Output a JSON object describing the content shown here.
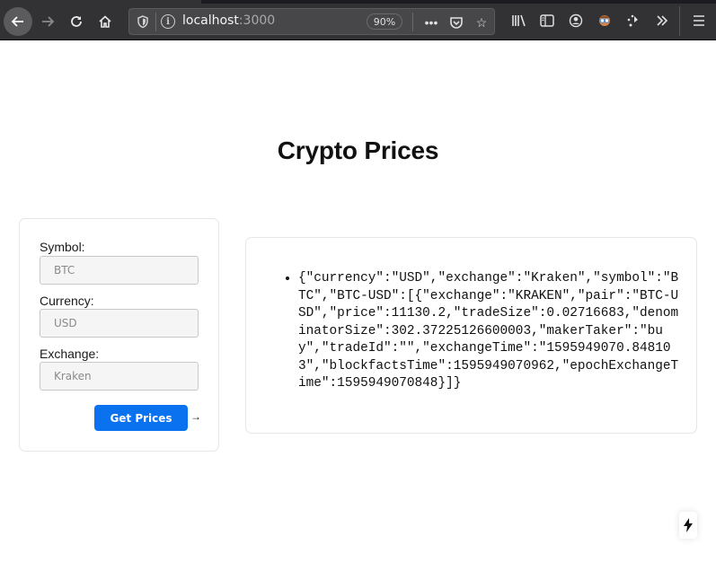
{
  "browser": {
    "url_host": "localhost",
    "url_port": ":3000",
    "zoom_level": "90%",
    "icons": {
      "back": "back-arrow-icon",
      "forward": "forward-arrow-icon",
      "reload": "reload-icon",
      "home": "home-icon",
      "tracking": "shield-icon",
      "info": "info-icon",
      "more": "more-dots-icon",
      "pocket": "pocket-icon",
      "bookmark": "star-icon",
      "library": "library-icon",
      "sidebar": "sidebar-icon",
      "account": "account-icon",
      "extension": "extension-avatar-icon",
      "extension2": "dots-arrow-icon",
      "overflow": "chevron-double-right-icon",
      "menu": "hamburger-menu-icon"
    }
  },
  "page": {
    "title": "Crypto Prices",
    "form": {
      "fields": [
        {
          "label": "Symbol:",
          "placeholder": "BTC",
          "value": ""
        },
        {
          "label": "Currency:",
          "placeholder": "USD",
          "value": ""
        },
        {
          "label": "Exchange:",
          "placeholder": "Kraken",
          "value": ""
        }
      ],
      "submit_label": "Get Prices",
      "arrow": "→"
    },
    "results": [
      "{\"currency\":\"USD\",\"exchange\":\"Kraken\",\"symbol\":\"BTC\",\"BTC-USD\":[{\"exchange\":\"KRAKEN\",\"pair\":\"BTC-USD\",\"price\":11130.2,\"tradeSize\":0.02716683,\"denominatorSize\":302.37225126600003,\"makerTaker\":\"buy\",\"tradeId\":\"\",\"exchangeTime\":\"1595949070.848103\",\"blockfactsTime\":1595949070962,\"epochExchangeTime\":1595949070848}]}"
    ],
    "accent_color": "#0a72ef"
  }
}
